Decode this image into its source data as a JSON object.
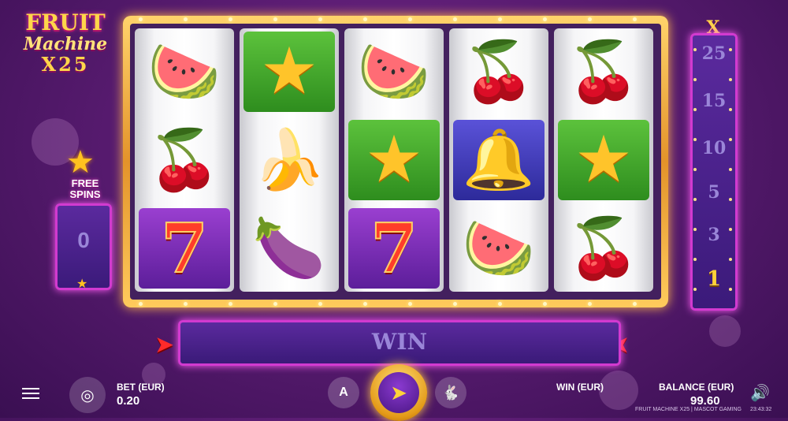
{
  "logo": {
    "line1": "FRUIT",
    "line2": "Machine",
    "line3": "X25"
  },
  "free_spins": {
    "label_line1": "FREE",
    "label_line2": "SPINS",
    "count": "0"
  },
  "reels": [
    [
      "watermelon",
      "cherries",
      "seven"
    ],
    [
      "star",
      "banana",
      "plum"
    ],
    [
      "watermelon",
      "star",
      "seven"
    ],
    [
      "cherries",
      "bell",
      "watermelon"
    ],
    [
      "cherries",
      "star",
      "cherries"
    ]
  ],
  "multiplier": {
    "header": "X",
    "values": [
      "25",
      "15",
      "10",
      "5",
      "3",
      "1"
    ],
    "active": "1"
  },
  "win_bar": {
    "label": "WIN"
  },
  "bottom_bar": {
    "bet_label": "BET (EUR)",
    "bet_value": "0.20",
    "win_label": "WIN (EUR)",
    "balance_label": "BALANCE (EUR)",
    "balance_value": "99.60",
    "auto_label": "A"
  },
  "footer": {
    "text": "FRUIT MACHINE X25 | MASCOT GAMING",
    "clock": "23:43:32"
  },
  "colors": {
    "frame_gold": "#e3932a",
    "panel_purple": "#5b2a9e",
    "neon_pink": "#d23ad0",
    "background": "#5a1c72"
  }
}
